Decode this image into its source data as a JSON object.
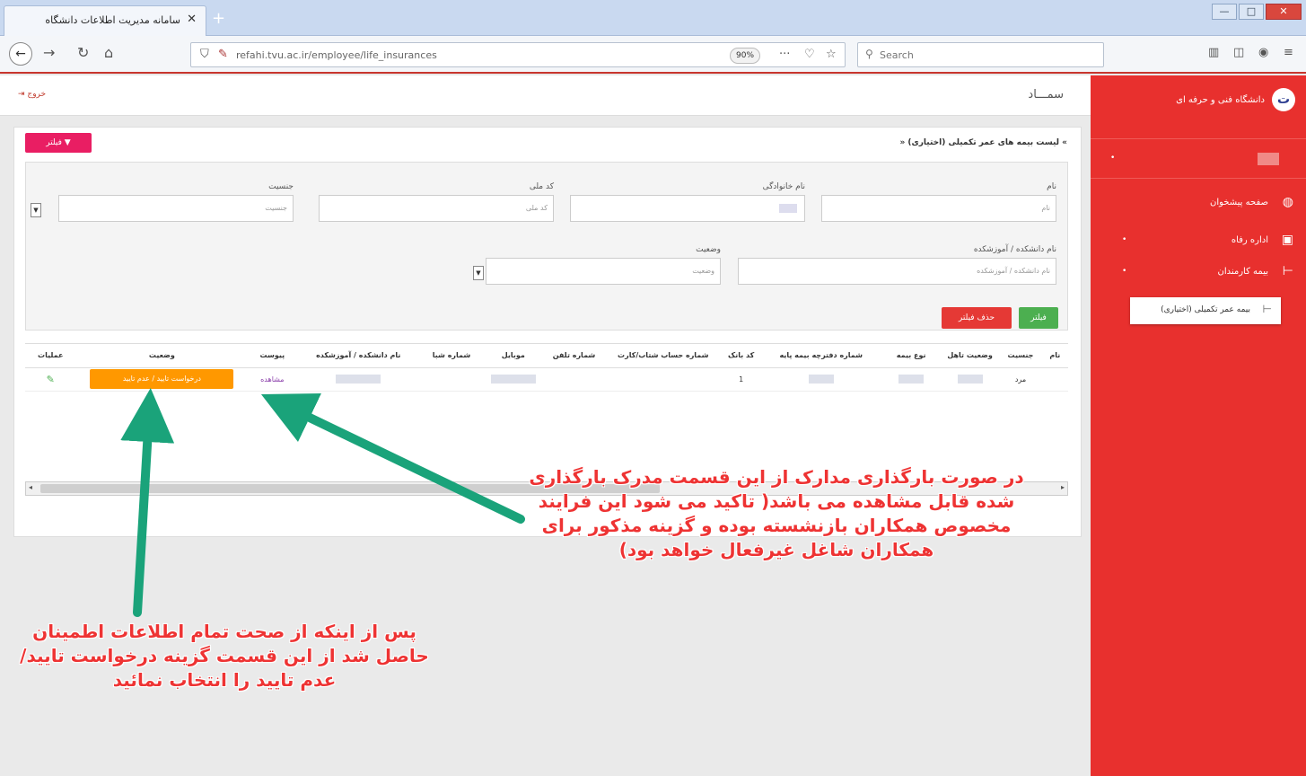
{
  "browser": {
    "tab_title": "سامانه مدیریت اطلاعات دانشگاه",
    "tab_close": "✕",
    "new_tab": "+",
    "url": "refahi.tvu.ac.ir/employee/life_insurances",
    "zoom": "90%",
    "search_placeholder": "Search",
    "window_min": "—",
    "window_max": "□",
    "window_close": "✕"
  },
  "sidebar": {
    "brand_name": "دانشگاه فنی و حرفه ای",
    "logo_glyph": "ت",
    "items": [
      {
        "label": "صفحه پیشخوان",
        "icon": "dashboard-icon"
      },
      {
        "label": "اداره رفاه",
        "icon": "briefcase-icon"
      },
      {
        "label": "بیمه کارمندان",
        "icon": "tree-line-icon"
      }
    ],
    "submenu_label": "بیمه عمر تکمیلی (اختیاری)"
  },
  "header": {
    "logout": "خروج",
    "app_name": "سمـــاد"
  },
  "panel": {
    "title": "» لیست بیمه های عمر تکمیلی (اختیاری) «",
    "filter_toggle": "فیلتر"
  },
  "filters": {
    "name_label": "نام",
    "name_placeholder": "نام",
    "family_label": "نام خانوادگی",
    "national_code_label": "کد ملی",
    "national_code_placeholder": "کد ملی",
    "gender_label": "جنسیت",
    "gender_value": "جنسیت",
    "college_label": "نام دانشکده / آموزشکده",
    "college_placeholder": "نام دانشکده / آموزشکده",
    "status_label": "وضعیت",
    "status_value": "وضعیت",
    "apply_button": "فیلتر",
    "remove_button": "حذف فیلتر"
  },
  "table": {
    "columns": [
      "نام",
      "جنسیت",
      "وضعیت تاهل",
      "نوع بیمه",
      "شماره دفترچه بیمه پایه",
      "کد بانک",
      "شماره حساب شتاب/کارت",
      "شماره تلفن",
      "موبایل",
      "شماره شبا",
      "نام دانشکده / آموزشکده",
      "پیوست",
      "وضعیت",
      "عملیات"
    ],
    "rows": [
      {
        "gender": "مرد",
        "bank_code": "1",
        "attachment": "مشاهده",
        "status": "درخواست تایید / عدم تایید"
      }
    ]
  },
  "annotations": {
    "note1": "در صورت بارگذاری مدارک از این قسمت مدرک بارگذاری شده قابل مشاهده می باشد( تاکید می شود این فرایند مخصوص همکاران بازنشسته بوده و گزینه مذکور برای همکاران شاغل غیرفعال خواهد بود)",
    "note2": "پس از اینکه از صحت تمام اطلاعات اطمینان حاصل شد از این قسمت گزینه درخواست تایید/عدم تایید را انتخاب نمائید"
  },
  "colors": {
    "sidebar": "#e8302e",
    "accent_pink": "#e91e63",
    "btn_green": "#4caf50",
    "btn_red": "#e53935",
    "status_orange": "#ff9800",
    "arrow_green": "#1aa37a",
    "note_red": "#ee3333"
  }
}
